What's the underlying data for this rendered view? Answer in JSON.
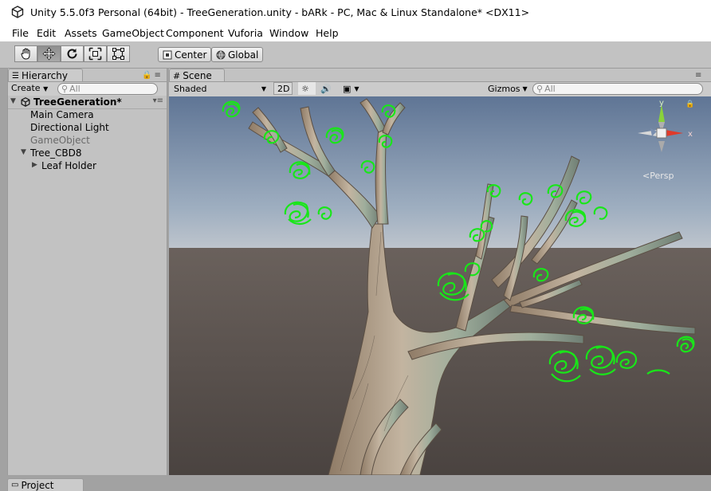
{
  "window": {
    "title": "Unity 5.5.0f3 Personal (64bit) - TreeGeneration.unity - bARk - PC, Mac & Linux Standalone* <DX11>",
    "app_icon": "unity-logo-icon"
  },
  "menu": [
    "File",
    "Edit",
    "Assets",
    "GameObject",
    "Component",
    "Vuforia",
    "Window",
    "Help"
  ],
  "toolbar": {
    "tools": [
      "hand-tool-icon",
      "move-tool-icon",
      "rotate-tool-icon",
      "scale-tool-icon",
      "rect-tool-icon"
    ],
    "active_tool": "move-tool-icon",
    "pivot_label": "Center",
    "space_label": "Global"
  },
  "hierarchy": {
    "tab_label": "Hierarchy",
    "create_label": "Create",
    "search_placeholder": "All",
    "scene_name": "TreeGeneration*",
    "items": [
      {
        "label": "Main Camera",
        "dim": false
      },
      {
        "label": "Directional Light",
        "dim": false
      },
      {
        "label": "GameObject",
        "dim": true
      },
      {
        "label": "Tree_CBD8",
        "dim": false
      },
      {
        "label": "Leaf Holder",
        "dim": false
      }
    ]
  },
  "scene": {
    "tab_label": "Scene",
    "shading_mode": "Shaded",
    "mode_2d_label": "2D",
    "gizmos_label": "Gizmos",
    "search_placeholder": "All",
    "gizmo_axes": {
      "y": "y",
      "x": "x"
    },
    "projection_label": "<Persp"
  },
  "project": {
    "tab_label": "Project"
  },
  "colors": {
    "leaf": "#19e619",
    "sky_top": "#5f7595",
    "ground": "#5a524f",
    "axis_x": "#e03a2a",
    "axis_y": "#8ad23a"
  }
}
